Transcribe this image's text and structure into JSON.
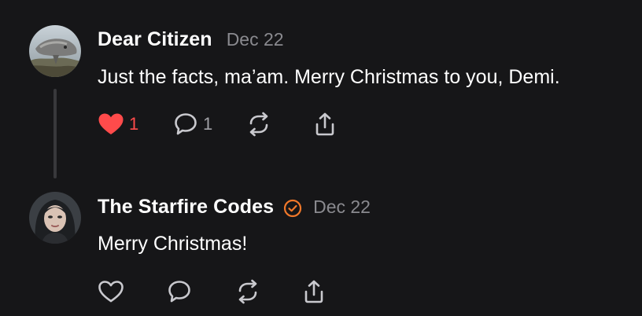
{
  "posts": [
    {
      "author": "Dear Citizen",
      "date": "Dec 22",
      "text": "Just the facts, ma’am. Merry Christmas to you, Demi.",
      "verified": false,
      "liked": true,
      "like_count": "1",
      "reply_count": "1"
    },
    {
      "author": "The Starfire Codes",
      "date": "Dec 22",
      "text": "Merry Christmas!",
      "verified": true,
      "liked": false
    }
  ],
  "colors": {
    "background": "#161618",
    "like_active": "#ff4b4b",
    "verified_badge": "#f0782a",
    "muted": "#8a8a8f",
    "icon": "#c9c9ce"
  },
  "icons": {
    "like": "heart-icon",
    "reply": "comment-bubble-icon",
    "repost": "repost-arrows-icon",
    "share": "share-upload-icon",
    "verified": "verified-check-badge-icon"
  }
}
